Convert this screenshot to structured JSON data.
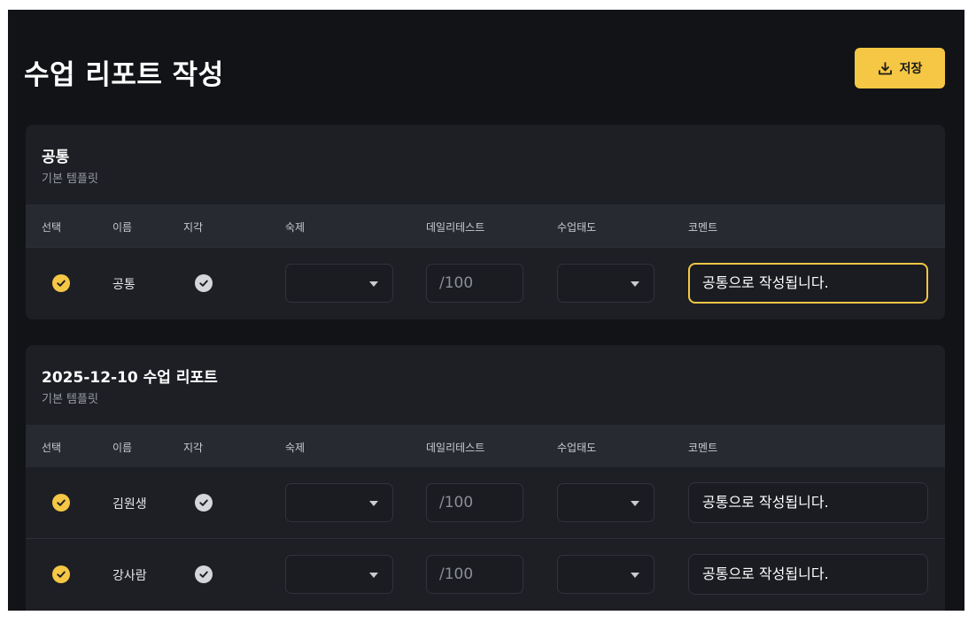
{
  "page": {
    "title": "수업 리포트 작성"
  },
  "toolbar": {
    "save_label": "저장",
    "save_icon": "download-icon"
  },
  "colors": {
    "accent": "#f5c744",
    "background": "#121317",
    "card": "#1d1f25",
    "table_header": "#272a31"
  },
  "columns": [
    "선택",
    "이름",
    "지각",
    "숙제",
    "데일리테스트",
    "수업태도",
    "코멘트"
  ],
  "common_card": {
    "title": "공통",
    "subtitle": "기본 템플릿",
    "row": {
      "selected": true,
      "name": "공통",
      "late": true,
      "homework": "",
      "score_placeholder": "/100",
      "attitude": "",
      "comment": "공통으로 작성됩니다."
    }
  },
  "report_card": {
    "title": "2025-12-10 수업 리포트",
    "subtitle": "기본 템플릿",
    "rows": [
      {
        "selected": true,
        "name": "김원생",
        "late": true,
        "homework": "",
        "score_placeholder": "/100",
        "attitude": "",
        "comment": "공통으로 작성됩니다."
      },
      {
        "selected": true,
        "name": "강사람",
        "late": true,
        "homework": "",
        "score_placeholder": "/100",
        "attitude": "",
        "comment": "공통으로 작성됩니다."
      }
    ]
  }
}
